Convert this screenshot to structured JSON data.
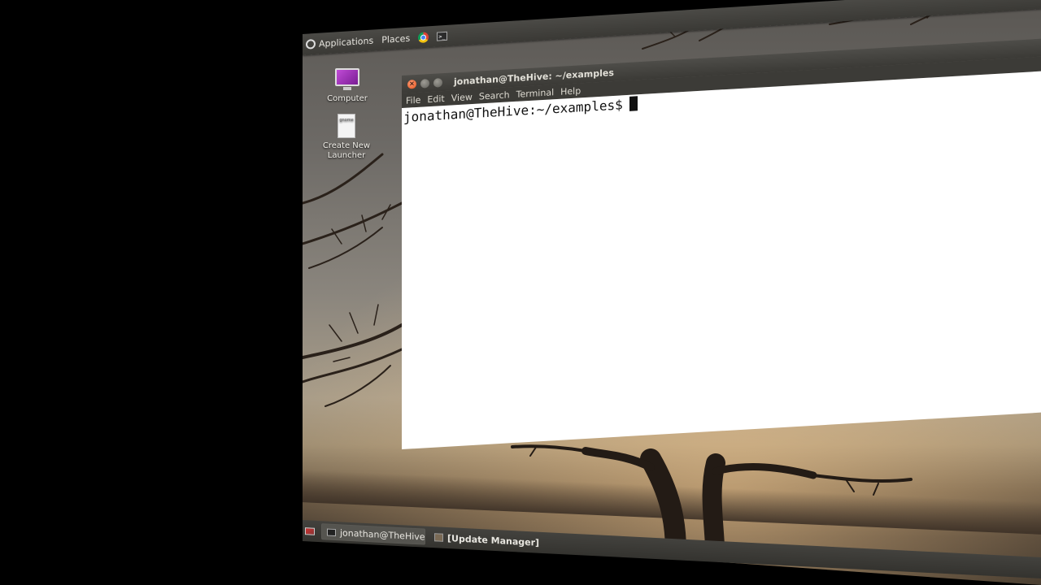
{
  "top_panel": {
    "applications_label": "Applications",
    "places_label": "Places",
    "terminal_launcher_glyph": ">_"
  },
  "desktop": {
    "icons": [
      {
        "label": "Computer"
      },
      {
        "label": "Create New Launcher",
        "file_glyph": "gnome"
      }
    ]
  },
  "terminal": {
    "title": "jonathan@TheHive: ~/examples",
    "close_glyph": "×",
    "menu": [
      "File",
      "Edit",
      "View",
      "Search",
      "Terminal",
      "Help"
    ],
    "prompt": "jonathan@TheHive:~/examples$"
  },
  "bottom_panel": {
    "tasks": [
      {
        "label": "jonathan@TheHive: ~/..."
      },
      {
        "label": "[Update Manager]"
      }
    ]
  },
  "colors": {
    "panel": "#3c3b37",
    "close_button": "#e2541e",
    "terminal_bg": "#ffffff",
    "computer_icon": "#9b30b8"
  }
}
